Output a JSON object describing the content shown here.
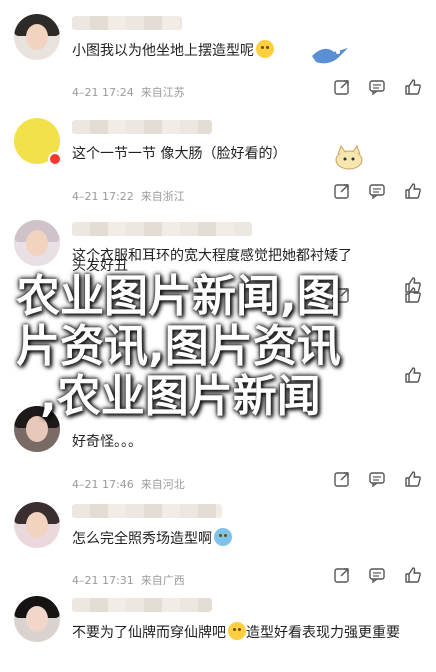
{
  "comments": [
    {
      "text": "小图我以为他坐地上摆造型呢",
      "date": "4–21 17:24",
      "location": "来自江苏"
    },
    {
      "text": "这个一节一节  像大肠（脸好看的）",
      "date": "4–21 17:22",
      "location": "来自浙江"
    },
    {
      "text": "这个衣服和耳环的宽大程度感觉把她都衬矮了",
      "date": "",
      "location": ""
    },
    {
      "text": "头发好丑",
      "date": "",
      "location": ""
    },
    {
      "text": "好奇怪。。。",
      "date": "4–21 17:46",
      "location": "来自河北"
    },
    {
      "text": "怎么完全照秀场造型啊",
      "date": "4–21 17:31",
      "location": "来自广西"
    },
    {
      "text": "不要为了仙牌而穿仙牌吧",
      "text2": "造型好看表现力强更重要",
      "date": "",
      "location": ""
    }
  ],
  "overlay": {
    "line1": "农业图片新闻,图",
    "line2": "片资讯,图片资讯",
    "line3": ",农业图片新闻"
  },
  "colors": {
    "like_icon": "#555555",
    "meta": "#9a9a9a",
    "badge": "#f5392c"
  },
  "icons": {
    "share": "share-icon",
    "reply": "reply-icon",
    "like": "thumbs-up-icon"
  }
}
